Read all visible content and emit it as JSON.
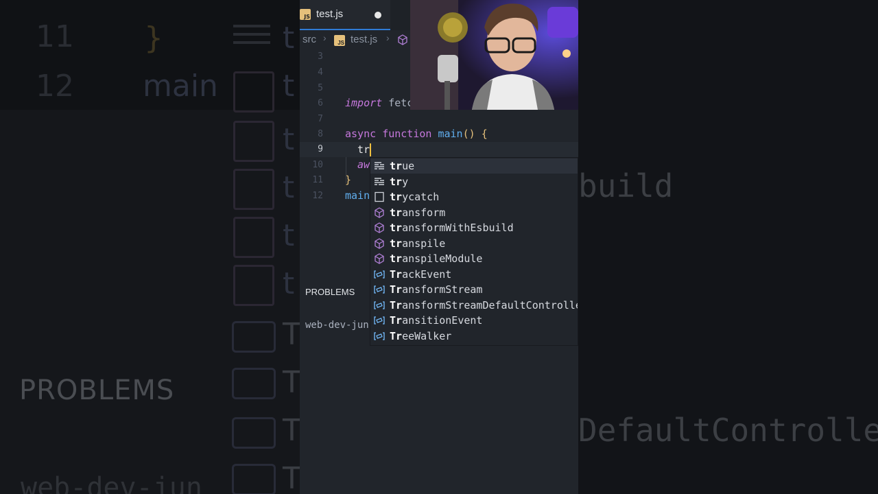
{
  "tab": {
    "label": "test.js",
    "badge": "JS"
  },
  "breadcrumb": {
    "folder": "src",
    "file": "test.js"
  },
  "code": {
    "line_numbers": [
      "3",
      "4",
      "5",
      "6",
      "7",
      "8",
      "9",
      "10",
      "11",
      "12"
    ],
    "line6": {
      "keyword": "import",
      "rest": " fetc"
    },
    "line8": {
      "async": "async",
      "function": "function",
      "name": "main",
      "parens": "()",
      "brace": "{"
    },
    "line9_typed": "tr",
    "line10_partial": "aw",
    "line11": "}",
    "line12": "main"
  },
  "suggestions": [
    {
      "match": "tr",
      "rest": "ue",
      "icon": "keyword-icon"
    },
    {
      "match": "tr",
      "rest": "y",
      "icon": "keyword-icon"
    },
    {
      "match": "tr",
      "rest": "ycatch",
      "icon": "snippet-icon"
    },
    {
      "match": "tr",
      "rest": "ansform",
      "icon": "module-icon"
    },
    {
      "match": "tr",
      "rest": "ansformWithEsbuild",
      "icon": "module-icon"
    },
    {
      "match": "tr",
      "rest": "anspile",
      "icon": "module-icon"
    },
    {
      "match": "tr",
      "rest": "anspileModule",
      "icon": "module-icon"
    },
    {
      "match": "Tr",
      "rest": "ackEvent",
      "icon": "variable-icon"
    },
    {
      "match": "Tr",
      "rest": "ansformStream",
      "icon": "variable-icon"
    },
    {
      "match": "Tr",
      "rest": "ansformStreamDefaultControlle",
      "icon": "variable-icon"
    },
    {
      "match": "Tr",
      "rest": "ansitionEvent",
      "icon": "variable-icon"
    },
    {
      "match": "Tr",
      "rest": "eeWalker",
      "icon": "variable-icon"
    }
  ],
  "panel": {
    "problems": "PROBLEMS",
    "terminal": "web-dev-jun"
  },
  "background": {
    "left_lines": [
      "11",
      "12"
    ],
    "left_code": [
      "}",
      "main"
    ],
    "left_letters": [
      "t",
      "t",
      "t",
      "t",
      "t",
      "t",
      "T",
      "T",
      "T",
      "T"
    ],
    "left_problems": "PROBLEMS",
    "left_bottom": "web-dev-jun",
    "right_words": [
      "build",
      "DefaultControlle"
    ]
  },
  "colors": {
    "editor_bg": "#21252b",
    "keyword": "#c678dd",
    "function": "#61afef",
    "bracket": "#e5c07b",
    "cursor": "#f0c040"
  }
}
